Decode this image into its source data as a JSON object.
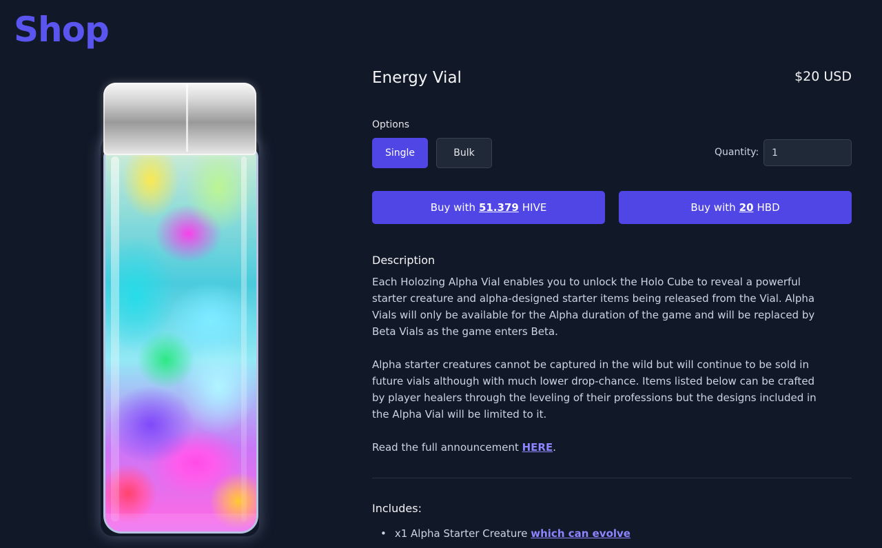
{
  "header": {
    "title": "Shop"
  },
  "product": {
    "name": "Energy Vial",
    "price": "$20 USD",
    "options_label": "Options",
    "options": [
      "Single",
      "Bulk"
    ],
    "selected_option": "Single",
    "quantity_label": "Quantity:",
    "quantity_value": "1",
    "buy_hive": {
      "prefix": "Buy with",
      "amount": "51.379",
      "currency": "HIVE"
    },
    "buy_hbd": {
      "prefix": "Buy with",
      "amount": "20",
      "currency": "HBD"
    }
  },
  "description": {
    "title": "Description",
    "p1": "Each Holozing Alpha Vial enables you to unlock the Holo Cube to reveal a powerful starter creature and alpha-designed starter items being released from the Vial. Alpha Vials will only be available for the Alpha duration of the game and will be replaced by Beta Vials as the game enters Beta.",
    "p2": "Alpha starter creatures cannot be captured in the wild but will continue to be sold in future vials although with much lower drop-chance. Items listed below can be crafted by player healers through the leveling of their professions but the designs included in the Alpha Vial will be limited to it.",
    "p3_prefix": "Read the full announcement",
    "p3_link": "HERE",
    "p3_suffix": "."
  },
  "includes": {
    "title": "Includes:",
    "items": [
      {
        "text": "x1 Alpha Starter Creature",
        "link": "which can evolve"
      }
    ]
  },
  "colors": {
    "background": "#111827",
    "accent": "#4f46e5",
    "brand": "#5b55f0",
    "link": "#8b85ff"
  }
}
